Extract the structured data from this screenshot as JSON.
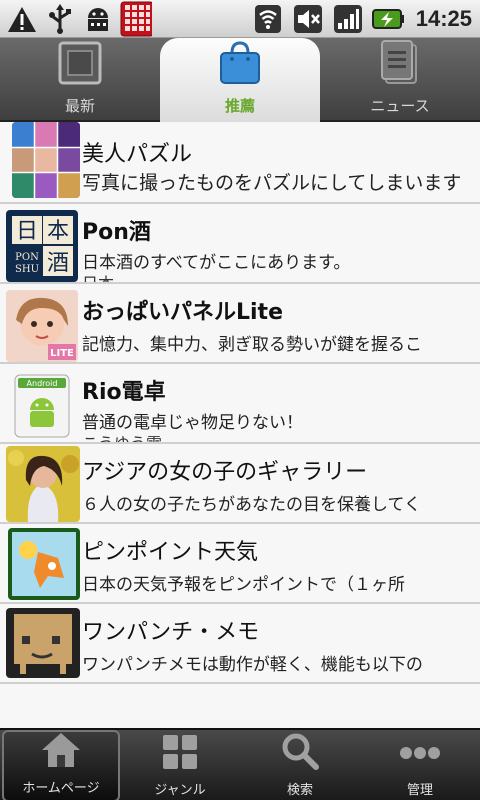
{
  "status": {
    "time": "14:25"
  },
  "tabs": [
    {
      "label": "最新",
      "icon": "square-frame-icon"
    },
    {
      "label": "推薦",
      "icon": "shopping-bag-icon",
      "active": true
    },
    {
      "label": "ニュース",
      "icon": "document-icon"
    }
  ],
  "apps": [
    {
      "title": "美人パズル",
      "desc": "写真に撮ったものをパズルにしてしまいます",
      "author": ""
    },
    {
      "title": "Pon酒",
      "desc": "日本酒のすべてがここにあります。",
      "author": "日本"
    },
    {
      "title": "おっぱいパネルLite",
      "desc": "記憶力、集中力、剥ぎ取る勢いが鍵を握るこ",
      "author": ""
    },
    {
      "title": "Rio電卓",
      "desc": "普通の電卓じゃ物足りない！",
      "author": "こうゆう電"
    },
    {
      "title": "アジアの女の子のギャラリー",
      "desc": "６人の女の子たちがあなたの目を保養してく",
      "author": ""
    },
    {
      "title": "ピンポイント天気",
      "desc": "日本の天気予報をピンポイントで（１ヶ所",
      "author": ""
    },
    {
      "title": "ワンパンチ・メモ",
      "desc": "ワンパンチメモは動作が軽く、機能も以下の",
      "author": ""
    }
  ],
  "thumb_text": {
    "ponshu": [
      "日",
      "本",
      "PON",
      "酒",
      "SHU"
    ],
    "lite": "LITE",
    "android": "Android"
  },
  "bottom_nav": [
    {
      "label": "ホームページ",
      "icon": "home-icon",
      "active": true
    },
    {
      "label": "ジャンル",
      "icon": "grid-icon"
    },
    {
      "label": "検索",
      "icon": "search-icon"
    },
    {
      "label": "管理",
      "icon": "more-dots-icon"
    }
  ],
  "colors": {
    "accent": "#6aa82c",
    "list_bg": "#f7f7f7",
    "divider": "#cfcfcf"
  }
}
